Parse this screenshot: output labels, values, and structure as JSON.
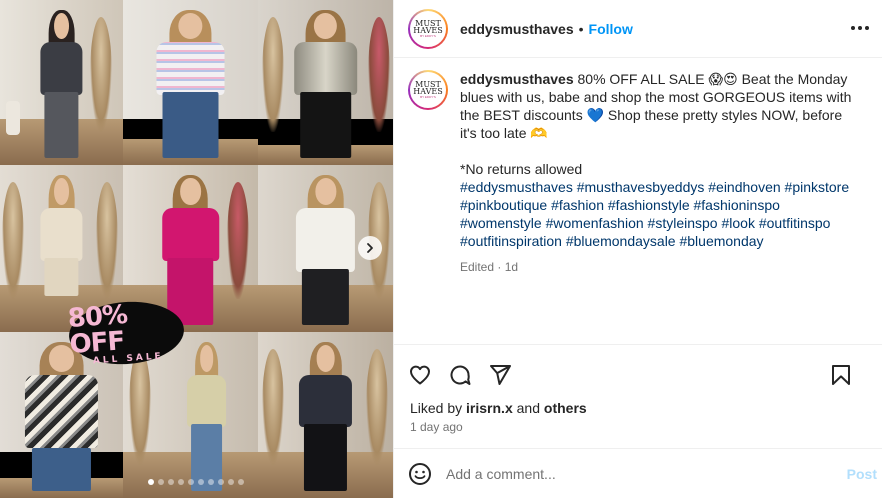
{
  "post": {
    "username": "eddysmusthaves",
    "separator": "•",
    "follow_label": "Follow",
    "avatar_logo_text": "MUST HAVES",
    "avatar_logo_sub": "BY EDDY'S"
  },
  "media": {
    "sale_badge": {
      "big": "80% OFF",
      "small": "ALL SALE"
    },
    "carousel": {
      "total": 10,
      "active": 0
    }
  },
  "caption": {
    "username": "eddysmusthaves",
    "text": " 80% OFF ALL SALE 😱😍 Beat the Monday blues with us, babe and shop the most GORGEOUS items with the BEST discounts 💙 Shop these pretty styles NOW, before it's too late 🫶",
    "note": "*No returns allowed",
    "hashtags": "#eddysmusthaves #musthavesbyeddys #eindhoven #pinkstore #pinkboutique #fashion #fashionstyle #fashioninspo #womenstyle #womenfashion #styleinspo #look #outfitinspo #outfitinspiration #bluemondaysale #bluemonday",
    "edited": "Edited · 1d"
  },
  "engagement": {
    "liked_by_prefix": "Liked by ",
    "liked_by_user": "irisrn.x",
    "liked_by_and": " and ",
    "liked_by_others": "others",
    "timestamp": "1 day ago"
  },
  "comment": {
    "placeholder": "Add a comment...",
    "post_label": "Post"
  },
  "colors": {
    "link_blue": "#0095f6",
    "hashtag_blue": "#00376b",
    "badge_pink": "#f6b8d4"
  },
  "icons": [
    "more-icon",
    "heart-icon",
    "comment-icon",
    "share-icon",
    "bookmark-icon",
    "emoji-icon",
    "chevron-right-icon"
  ]
}
